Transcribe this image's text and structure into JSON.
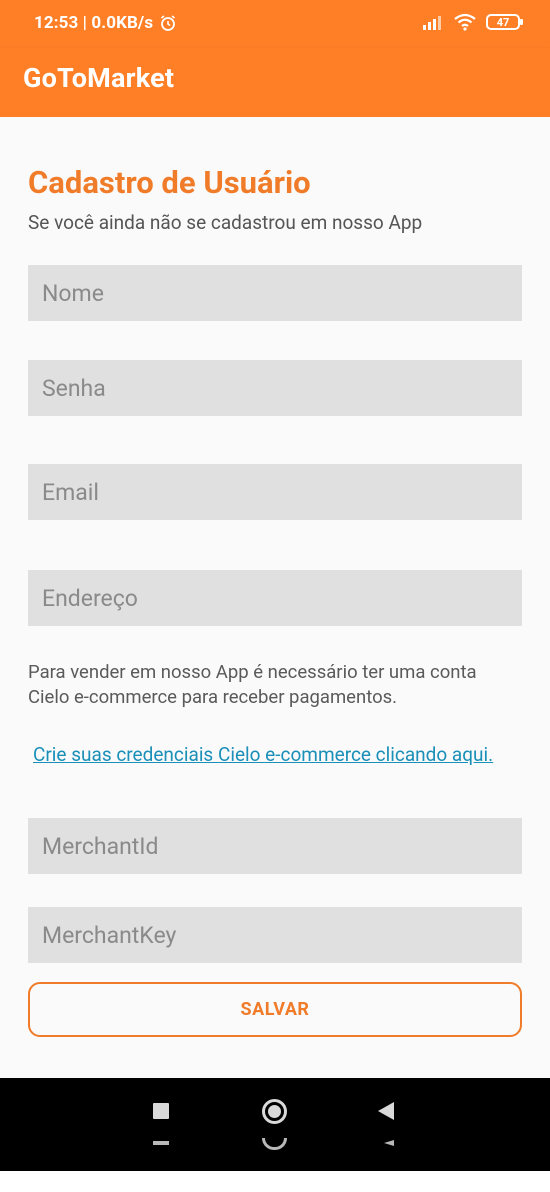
{
  "status_bar": {
    "time_speed": "12:53 | 0.0KB/s",
    "battery": "47"
  },
  "app_bar": {
    "title": "GoToMarket"
  },
  "form": {
    "title": "Cadastro de Usuário",
    "subtitle": "Se você ainda não se cadastrou em nosso App",
    "fields": {
      "name": "Nome",
      "password": "Senha",
      "email": "Email",
      "address": "Endereço",
      "merchant_id": "MerchantId",
      "merchant_key": "MerchantKey"
    },
    "info_line1": "Para vender em nosso App é necessário ter uma conta",
    "info_line2": "Cielo e-commerce para receber pagamentos.",
    "link": "Crie suas credenciais Cielo e-commerce clicando aqui.",
    "save_label": "SALVAR"
  },
  "colors": {
    "accent": "#ff7f27",
    "link": "#1a8fb8",
    "field_bg": "#e0e0e0"
  }
}
